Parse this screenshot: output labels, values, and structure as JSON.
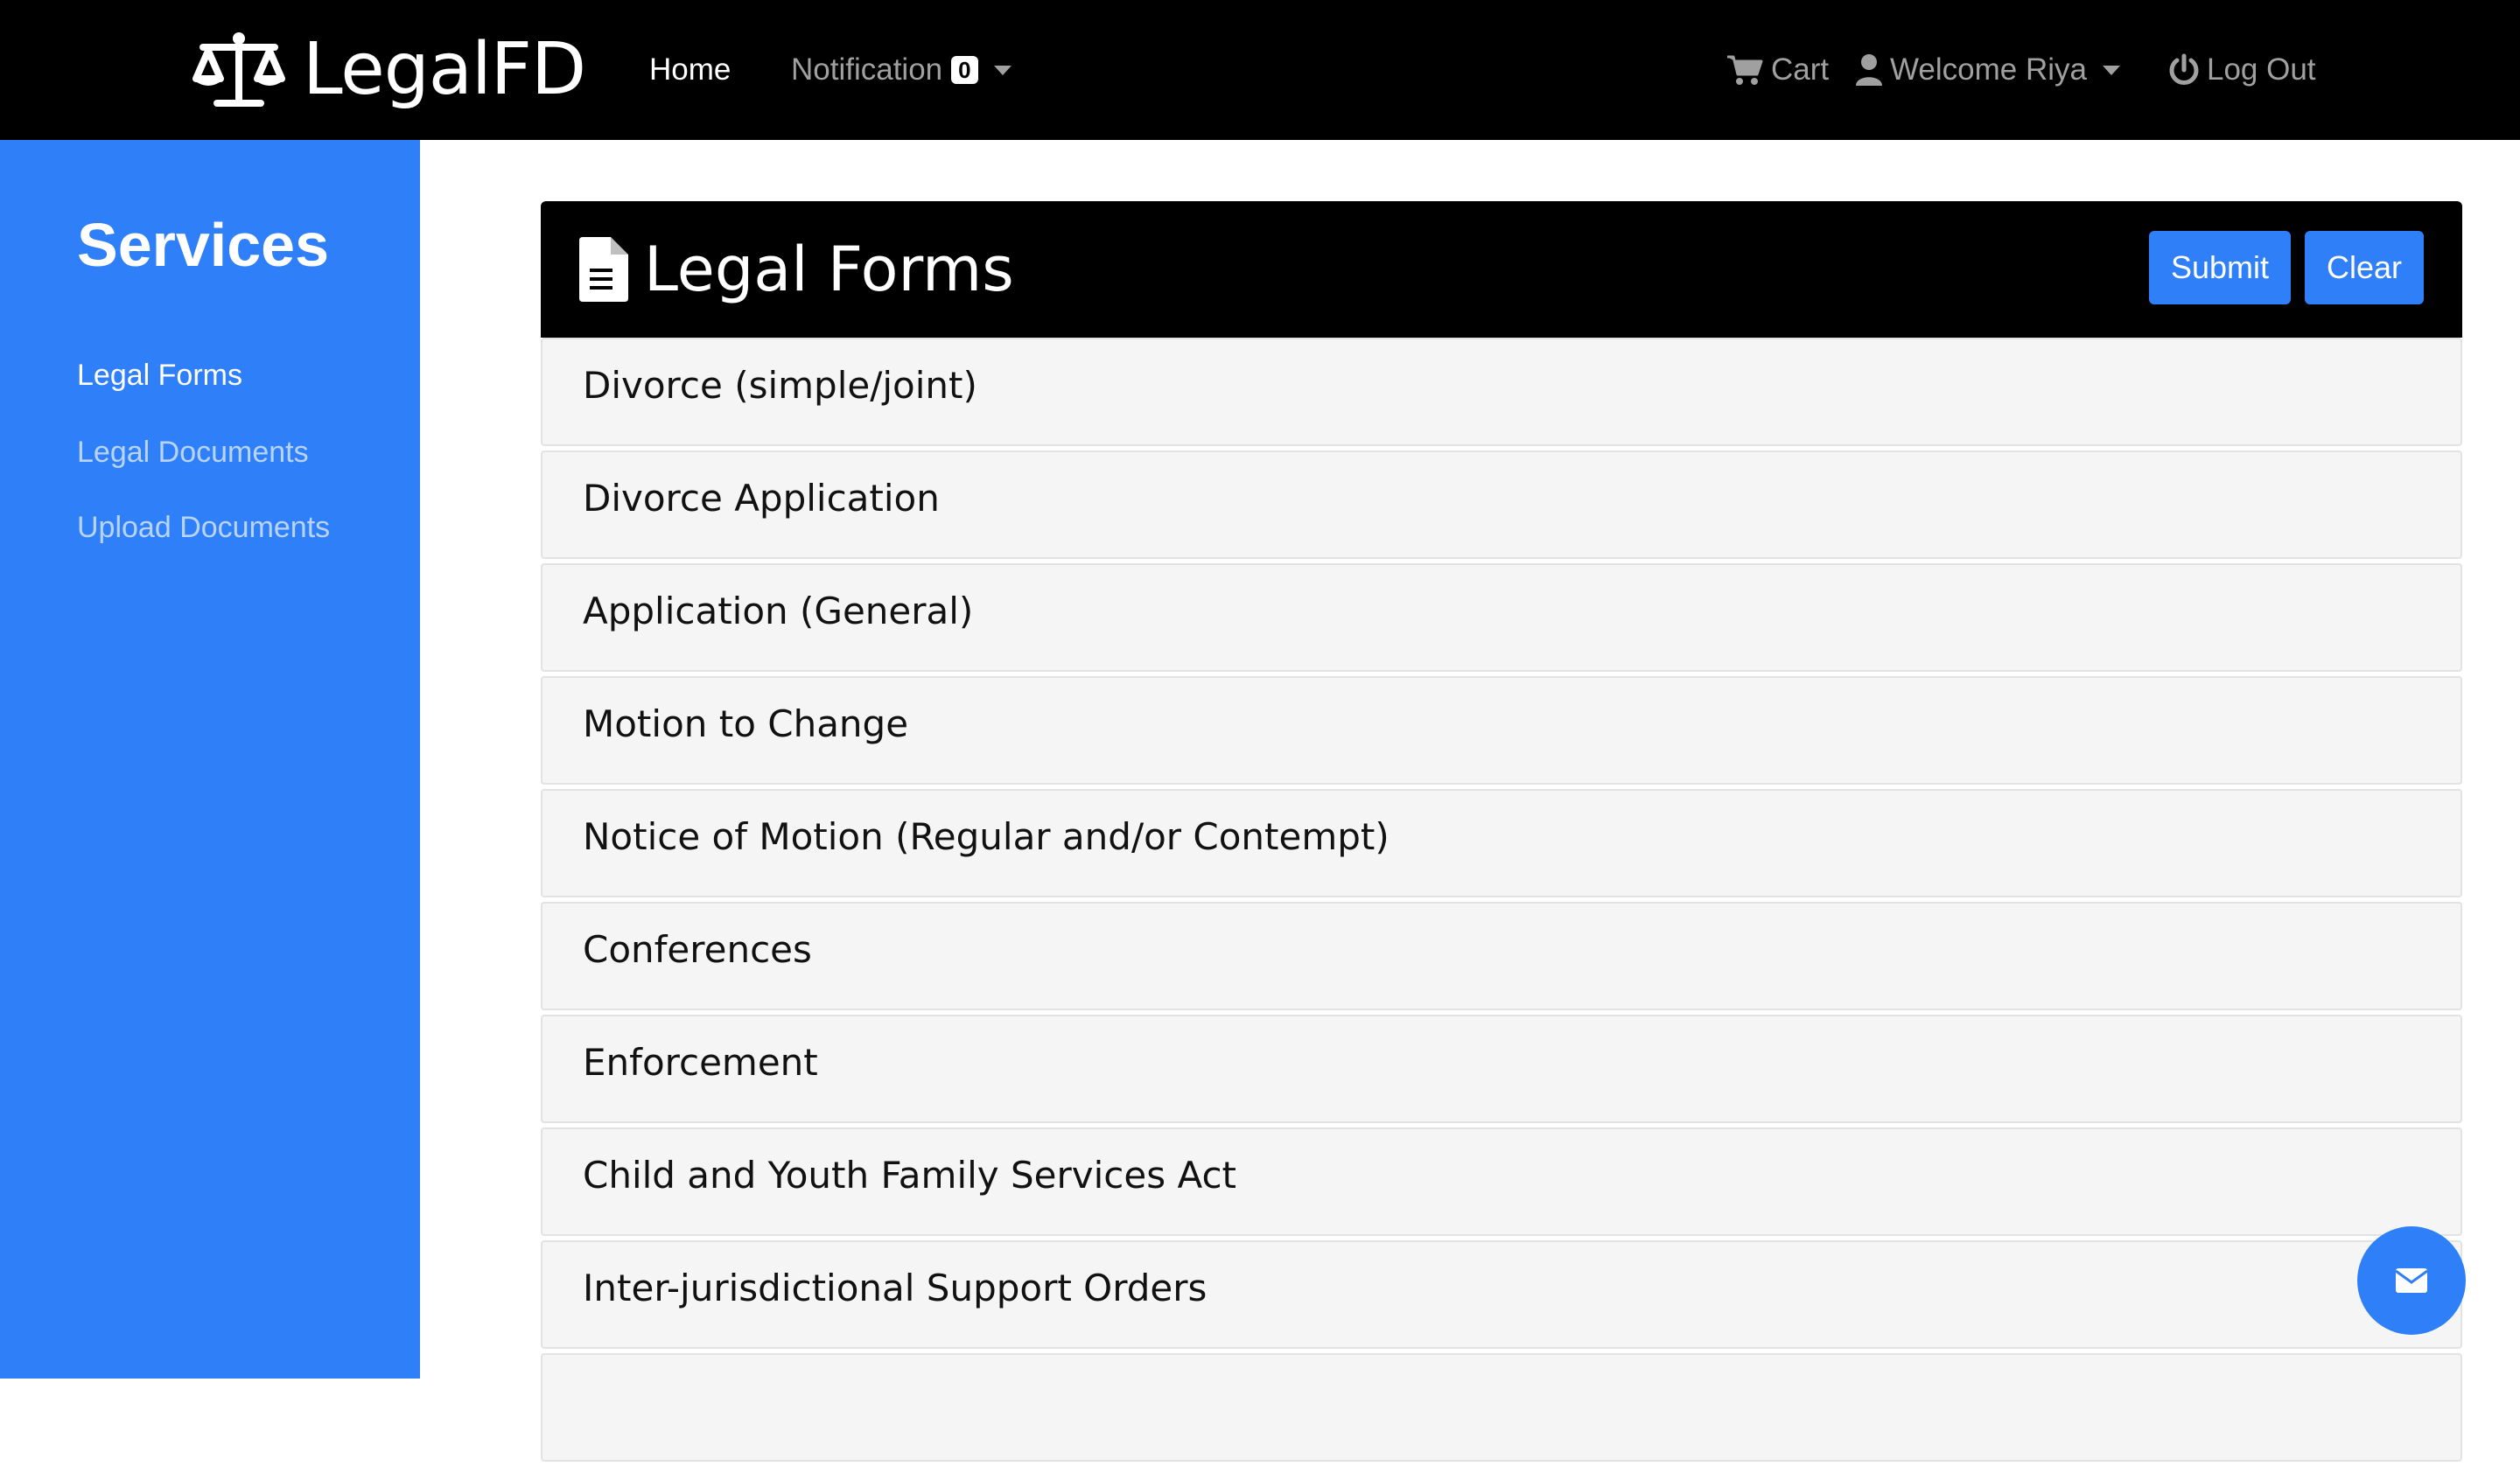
{
  "navbar": {
    "brand": "LegalFD",
    "home": "Home",
    "notification_label": "Notification",
    "notification_count": "0",
    "cart": "Cart",
    "welcome": "Welcome Riya",
    "logout": "Log Out"
  },
  "sidebar": {
    "title": "Services",
    "items": [
      {
        "label": "Legal Forms",
        "active": true
      },
      {
        "label": "Legal Documents",
        "active": false
      },
      {
        "label": "Upload Documents",
        "active": false
      }
    ]
  },
  "main": {
    "title": "Legal Forms",
    "submit_label": "Submit",
    "clear_label": "Clear",
    "forms": [
      "Divorce (simple/joint)",
      "Divorce Application",
      "Application (General)",
      "Motion to Change",
      "Notice of Motion (Regular and/or Contempt)",
      "Conferences",
      "Enforcement",
      "Child and Youth Family Services Act",
      "Inter-jurisdictional Support Orders",
      ""
    ]
  },
  "colors": {
    "navbar_bg": "#000000",
    "sidebar_bg": "#2f80f8",
    "accent": "#2f80f8",
    "item_bg": "#f5f5f5"
  },
  "icons": {
    "brand": "scales-icon",
    "cart": "cart-icon",
    "user": "user-icon",
    "logout": "power-icon",
    "panel": "document-icon",
    "fab": "envelope-icon"
  }
}
